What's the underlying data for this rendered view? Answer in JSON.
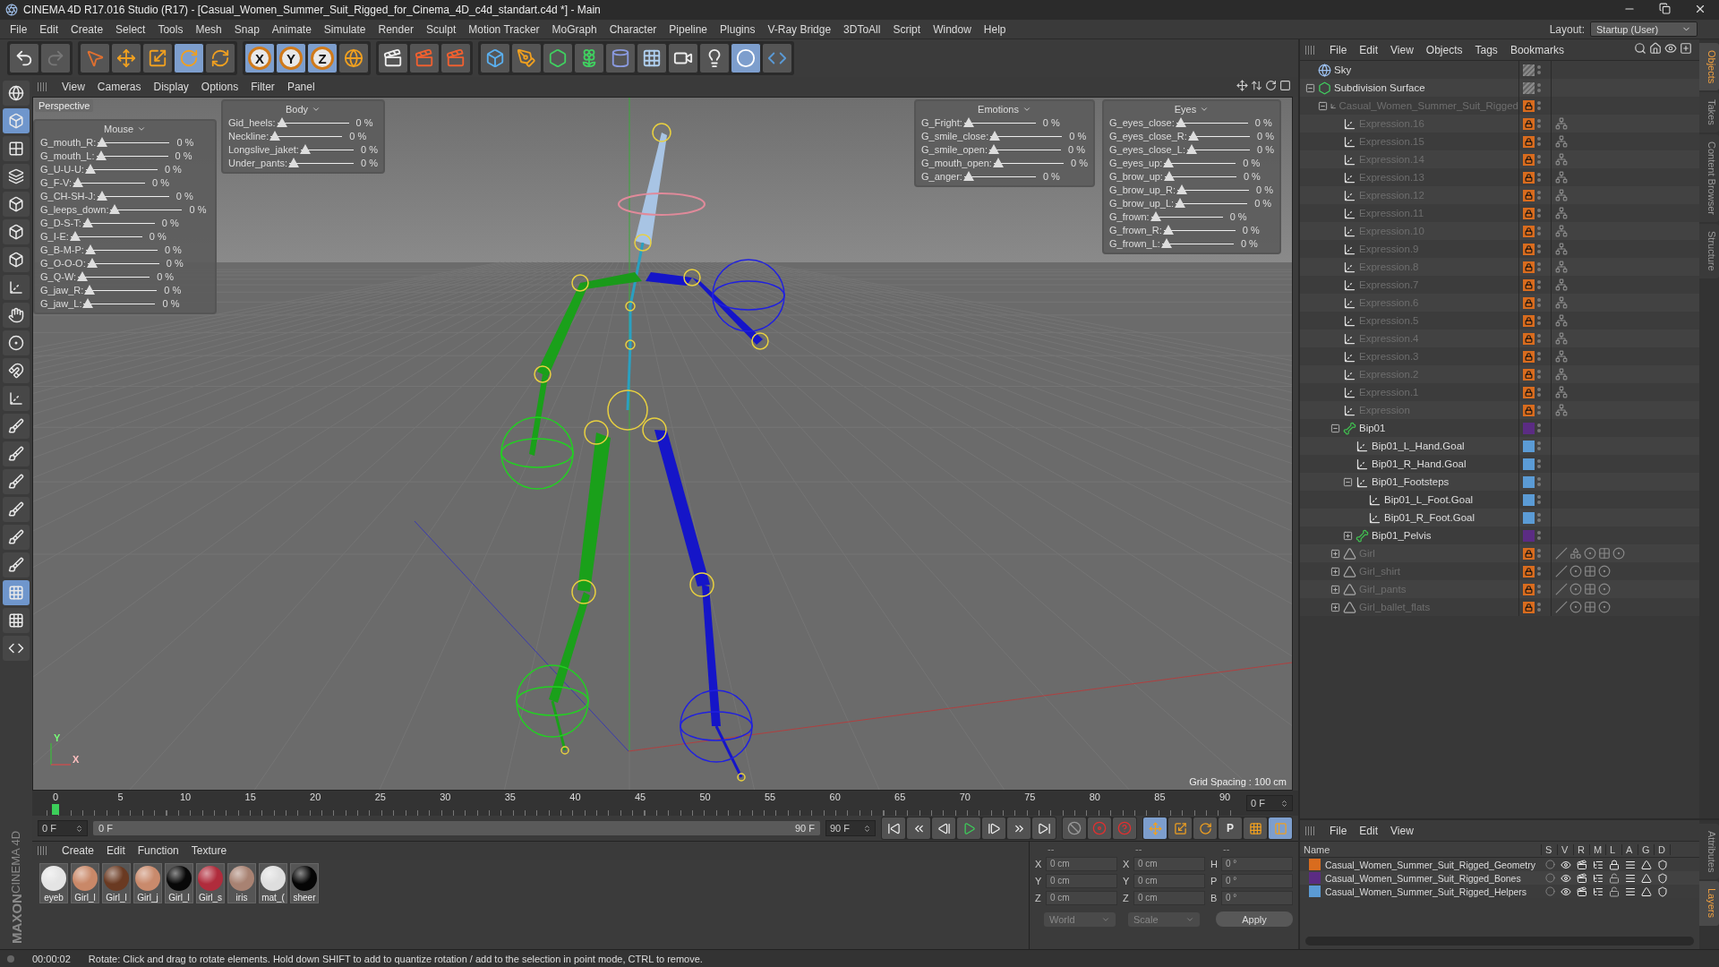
{
  "window": {
    "title": "CINEMA 4D R17.016 Studio (R17) - [Casual_Women_Summer_Suit_Rigged_for_Cinema_4D_c4d_standart.c4d *] - Main"
  },
  "menu": [
    "File",
    "Edit",
    "Create",
    "Select",
    "Tools",
    "Mesh",
    "Snap",
    "Animate",
    "Simulate",
    "Render",
    "Sculpt",
    "Motion Tracker",
    "MoGraph",
    "Character",
    "Pipeline",
    "Plugins",
    "V-Ray Bridge",
    "3DToAll",
    "Script",
    "Window",
    "Help"
  ],
  "layout": {
    "label": "Layout:",
    "value": "Startup (User)"
  },
  "toolbar": [
    {
      "tools": [
        {
          "kind": "undo",
          "selected": false
        },
        {
          "kind": "redo",
          "selected": false
        }
      ]
    },
    {
      "tools": [
        {
          "kind": "select",
          "selected": false
        },
        {
          "kind": "move",
          "selected": false
        },
        {
          "kind": "scale",
          "selected": false
        },
        {
          "kind": "rotate",
          "selected": true
        },
        {
          "kind": "recent",
          "selected": false
        }
      ]
    },
    {
      "tools": [
        {
          "kind": "axis",
          "label": "X",
          "selected": true
        },
        {
          "kind": "axis",
          "label": "Y",
          "selected": true
        },
        {
          "kind": "axis",
          "label": "Z",
          "selected": true
        },
        {
          "kind": "world",
          "selected": false
        }
      ]
    },
    {
      "tools": [
        {
          "kind": "render-view",
          "selected": false
        },
        {
          "kind": "render",
          "selected": false
        },
        {
          "kind": "render-settings",
          "selected": false
        }
      ]
    },
    {
      "tools": [
        {
          "kind": "cube",
          "selected": false
        },
        {
          "kind": "pen",
          "selected": false
        },
        {
          "kind": "subdivision",
          "selected": false
        },
        {
          "kind": "cloner",
          "selected": false
        },
        {
          "kind": "deformer",
          "selected": false
        },
        {
          "kind": "floor",
          "selected": false
        },
        {
          "kind": "camera",
          "selected": false
        },
        {
          "kind": "light",
          "selected": false
        },
        {
          "kind": "vray",
          "selected": true
        },
        {
          "kind": "python",
          "selected": false
        }
      ]
    }
  ],
  "side_tools": [
    {
      "kind": "viewport",
      "selected": false
    },
    {
      "kind": "model",
      "selected": true
    },
    {
      "kind": "texture",
      "selected": false
    },
    {
      "kind": "workplane",
      "selected": false
    },
    {
      "kind": "points",
      "selected": false
    },
    {
      "kind": "edges",
      "selected": false
    },
    {
      "kind": "polygons",
      "selected": false
    },
    {
      "kind": "axis",
      "selected": false
    },
    {
      "kind": "hand",
      "selected": false
    },
    {
      "kind": "snap",
      "selected": false
    },
    {
      "kind": "magnet",
      "selected": false
    },
    {
      "kind": "locked-axis",
      "selected": false
    },
    {
      "kind": "brush",
      "selected": false
    },
    {
      "kind": "brush",
      "selected": false
    },
    {
      "kind": "brush",
      "selected": false
    },
    {
      "kind": "brush",
      "selected": false
    },
    {
      "kind": "brush",
      "selected": false
    },
    {
      "kind": "brush",
      "selected": false
    },
    {
      "kind": "grid",
      "selected": true
    },
    {
      "kind": "grid",
      "selected": false
    },
    {
      "kind": "python",
      "selected": false
    }
  ],
  "logo": [
    "MAXON",
    "CINEMA 4D"
  ],
  "viewport": {
    "menu": [
      "View",
      "Cameras",
      "Display",
      "Options",
      "Filter",
      "Panel"
    ],
    "camera": "Perspective",
    "grid_spacing": "Grid Spacing : 100 cm",
    "gizmo_labels": [
      "Y",
      "X"
    ],
    "overlays": [
      {
        "title": "Mouse",
        "sliders": [
          {
            "label": "G_mouth_R:",
            "level": 0,
            "reading": "0 %"
          },
          {
            "label": "G_mouth_L:",
            "level": 0,
            "reading": "0 %"
          },
          {
            "label": "G_U-U-U:",
            "level": 0,
            "reading": "0 %"
          },
          {
            "label": "G_F-V:",
            "level": 0,
            "reading": "0 %"
          },
          {
            "label": "G_CH-SH-J:",
            "level": 0,
            "reading": "0 %"
          },
          {
            "label": "G_leeps_down:",
            "level": 0,
            "reading": "0 %"
          },
          {
            "label": "G_D-S-T:",
            "level": 0,
            "reading": "0 %"
          },
          {
            "label": "G_I-E:",
            "level": 0,
            "reading": "0 %"
          },
          {
            "label": "G_B-M-P:",
            "level": 0,
            "reading": "0 %"
          },
          {
            "label": "G_O-O-O:",
            "level": 0,
            "reading": "0 %"
          },
          {
            "label": "G_Q-W:",
            "level": 0,
            "reading": "0 %"
          },
          {
            "label": "G_jaw_R:",
            "level": 0,
            "reading": "0 %"
          },
          {
            "label": "G_jaw_L:",
            "level": 0,
            "reading": "0 %"
          }
        ]
      },
      {
        "title": "Body",
        "sliders": [
          {
            "label": "Gid_heels:",
            "level": 0,
            "reading": "0 %"
          },
          {
            "label": "Neckline:",
            "level": 0,
            "reading": "0 %"
          },
          {
            "label": "Longslive_jaket:",
            "level": 0,
            "reading": "0 %"
          },
          {
            "label": "Under_pants:",
            "level": 0,
            "reading": "0 %"
          }
        ]
      },
      {
        "title": "Emotions",
        "sliders": [
          {
            "label": "G_Fright:",
            "level": 0,
            "reading": "0 %"
          },
          {
            "label": "G_smile_close:",
            "level": 0,
            "reading": "0 %"
          },
          {
            "label": "G_smile_open:",
            "level": 0,
            "reading": "0 %"
          },
          {
            "label": "G_mouth_open:",
            "level": 0,
            "reading": "0 %"
          },
          {
            "label": "G_anger:",
            "level": 0,
            "reading": "0 %"
          }
        ]
      },
      {
        "title": "Eyes",
        "sliders": [
          {
            "label": "G_eyes_close:",
            "level": 0,
            "reading": "0 %"
          },
          {
            "label": "G_eyes_close_R:",
            "level": 0,
            "reading": "0 %"
          },
          {
            "label": "G_eyes_close_L:",
            "level": 0,
            "reading": "0 %"
          },
          {
            "label": "G_eyes_up:",
            "level": 0,
            "reading": "0 %"
          },
          {
            "label": "G_brow_up:",
            "level": 0,
            "reading": "0 %"
          },
          {
            "label": "G_brow_up_R:",
            "level": 0,
            "reading": "0 %"
          },
          {
            "label": "G_brow_up_L:",
            "level": 0,
            "reading": "0 %"
          },
          {
            "label": "G_frown:",
            "level": 0,
            "reading": "0 %"
          },
          {
            "label": "G_frown_R:",
            "level": 0,
            "reading": "0 %"
          },
          {
            "label": "G_frown_L:",
            "level": 0,
            "reading": "0 %"
          }
        ]
      }
    ]
  },
  "timeline": {
    "labels": [
      "0",
      "5",
      "10",
      "15",
      "20",
      "25",
      "30",
      "35",
      "40",
      "45",
      "50",
      "55",
      "60",
      "65",
      "70",
      "75",
      "80",
      "85",
      "90"
    ],
    "level": 0,
    "current": "0 F",
    "start": "0 F",
    "range": {
      "start": "0 F",
      "end": "90 F",
      "level": 1
    },
    "end": "90 F"
  },
  "transport": [
    {
      "kind": "first"
    },
    {
      "kind": "prev-key"
    },
    {
      "kind": "prev"
    },
    {
      "kind": "play"
    },
    {
      "kind": "next"
    },
    {
      "kind": "next-key"
    },
    {
      "kind": "last"
    }
  ],
  "record": [
    {
      "kind": "keyframe-off"
    },
    {
      "kind": "record"
    },
    {
      "kind": "auto-key"
    }
  ],
  "key_tools": [
    {
      "kind": "move",
      "selected": true
    },
    {
      "kind": "scale",
      "selected": false
    },
    {
      "kind": "rotate",
      "selected": false
    },
    {
      "kind": "param",
      "label": "P",
      "selected": false
    },
    {
      "kind": "points",
      "selected": false
    },
    {
      "kind": "timeline",
      "selected": true
    }
  ],
  "materials": {
    "menu": [
      "Create",
      "Edit",
      "Function",
      "Texture"
    ],
    "items": [
      {
        "name": "eyeb",
        "color": "#e4e4e4"
      },
      {
        "name": "Girl_l",
        "color": "#c98868"
      },
      {
        "name": "Girl_l",
        "color": "#6a3a22"
      },
      {
        "name": "Girl_j",
        "color": "#c98a6c"
      },
      {
        "name": "Girl_l",
        "color": "#080808"
      },
      {
        "name": "Girl_s",
        "color": "#b02c3c"
      },
      {
        "name": "iris",
        "color": "#a88272"
      },
      {
        "name": "mat_(",
        "color": "#dedede"
      },
      {
        "name": "sheer",
        "color": "#050505"
      }
    ]
  },
  "coordinates": {
    "headers": [
      "--",
      "--",
      "--"
    ],
    "rows": [
      [
        {
          "axis": "X",
          "value": "0 cm"
        },
        {
          "axis": "X",
          "value": "0 cm"
        },
        {
          "axis": "H",
          "value": "0 °"
        }
      ],
      [
        {
          "axis": "Y",
          "value": "0 cm"
        },
        {
          "axis": "Y",
          "value": "0 cm"
        },
        {
          "axis": "P",
          "value": "0 °"
        }
      ],
      [
        {
          "axis": "Z",
          "value": "0 cm"
        },
        {
          "axis": "Z",
          "value": "0 cm"
        },
        {
          "axis": "B",
          "value": "0 °"
        }
      ]
    ],
    "space": "World",
    "mode": "Scale",
    "apply": "Apply"
  },
  "objects": {
    "menu": [
      "File",
      "Edit",
      "View",
      "Objects",
      "Tags",
      "Bookmarks"
    ],
    "items": [
      {
        "name": "Sky",
        "kind": "sky",
        "dimmed": false
      },
      {
        "name": "Subdivision Surface",
        "kind": "subdivision",
        "dimmed": false,
        "expanded": true,
        "children": [
          {
            "name": "Casual_Women_Summer_Suit_Rigged",
            "kind": "null",
            "dimmed": true,
            "color": "#d96c1e",
            "locked": true,
            "expanded": true,
            "children": [
              {
                "name": "Expression.16",
                "kind": "null",
                "dimmed": true,
                "color": "#d96c1e",
                "locked": true,
                "tags": [
                  {
                    "kind": "xpresso"
                  }
                ]
              },
              {
                "name": "Expression.15",
                "kind": "null",
                "dimmed": true,
                "color": "#d96c1e",
                "locked": true,
                "tags": [
                  {
                    "kind": "xpresso"
                  }
                ]
              },
              {
                "name": "Expression.14",
                "kind": "null",
                "dimmed": true,
                "color": "#d96c1e",
                "locked": true,
                "tags": [
                  {
                    "kind": "xpresso"
                  }
                ]
              },
              {
                "name": "Expression.13",
                "kind": "null",
                "dimmed": true,
                "color": "#d96c1e",
                "locked": true,
                "tags": [
                  {
                    "kind": "xpresso"
                  }
                ]
              },
              {
                "name": "Expression.12",
                "kind": "null",
                "dimmed": true,
                "color": "#d96c1e",
                "locked": true,
                "tags": [
                  {
                    "kind": "xpresso"
                  }
                ]
              },
              {
                "name": "Expression.11",
                "kind": "null",
                "dimmed": true,
                "color": "#d96c1e",
                "locked": true,
                "tags": [
                  {
                    "kind": "xpresso"
                  }
                ]
              },
              {
                "name": "Expression.10",
                "kind": "null",
                "dimmed": true,
                "color": "#d96c1e",
                "locked": true,
                "tags": [
                  {
                    "kind": "xpresso"
                  }
                ]
              },
              {
                "name": "Expression.9",
                "kind": "null",
                "dimmed": true,
                "color": "#d96c1e",
                "locked": true,
                "tags": [
                  {
                    "kind": "xpresso"
                  }
                ]
              },
              {
                "name": "Expression.8",
                "kind": "null",
                "dimmed": true,
                "color": "#d96c1e",
                "locked": true,
                "tags": [
                  {
                    "kind": "xpresso"
                  }
                ]
              },
              {
                "name": "Expression.7",
                "kind": "null",
                "dimmed": true,
                "color": "#d96c1e",
                "locked": true,
                "tags": [
                  {
                    "kind": "xpresso"
                  }
                ]
              },
              {
                "name": "Expression.6",
                "kind": "null",
                "dimmed": true,
                "color": "#d96c1e",
                "locked": true,
                "tags": [
                  {
                    "kind": "xpresso"
                  }
                ]
              },
              {
                "name": "Expression.5",
                "kind": "null",
                "dimmed": true,
                "color": "#d96c1e",
                "locked": true,
                "tags": [
                  {
                    "kind": "xpresso"
                  }
                ]
              },
              {
                "name": "Expression.4",
                "kind": "null",
                "dimmed": true,
                "color": "#d96c1e",
                "locked": true,
                "tags": [
                  {
                    "kind": "xpresso"
                  }
                ]
              },
              {
                "name": "Expression.3",
                "kind": "null",
                "dimmed": true,
                "color": "#d96c1e",
                "locked": true,
                "tags": [
                  {
                    "kind": "xpresso"
                  }
                ]
              },
              {
                "name": "Expression.2",
                "kind": "null",
                "dimmed": true,
                "color": "#d96c1e",
                "locked": true,
                "tags": [
                  {
                    "kind": "xpresso"
                  }
                ]
              },
              {
                "name": "Expression.1",
                "kind": "null",
                "dimmed": true,
                "color": "#d96c1e",
                "locked": true,
                "tags": [
                  {
                    "kind": "xpresso"
                  }
                ]
              },
              {
                "name": "Expression",
                "kind": "null",
                "dimmed": true,
                "color": "#d96c1e",
                "locked": true,
                "tags": [
                  {
                    "kind": "xpresso"
                  }
                ]
              },
              {
                "name": "Bip01",
                "kind": "bone",
                "dimmed": false,
                "color": "#5b2c83",
                "locked": false,
                "expanded": true,
                "children": [
                  {
                    "name": "Bip01_L_Hand.Goal",
                    "kind": "null",
                    "dimmed": false,
                    "color": "#5b9bd5",
                    "locked": false
                  },
                  {
                    "name": "Bip01_R_Hand.Goal",
                    "kind": "null",
                    "dimmed": false,
                    "color": "#5b9bd5",
                    "locked": false
                  },
                  {
                    "name": "Bip01_Footsteps",
                    "kind": "null",
                    "dimmed": false,
                    "color": "#5b9bd5",
                    "locked": false,
                    "expanded": true,
                    "children": [
                      {
                        "name": "Bip01_L_Foot.Goal",
                        "kind": "null",
                        "dimmed": false,
                        "color": "#5b9bd5",
                        "locked": false
                      },
                      {
                        "name": "Bip01_R_Foot.Goal",
                        "kind": "null",
                        "dimmed": false,
                        "color": "#5b9bd5",
                        "locked": false
                      }
                    ]
                  },
                  {
                    "name": "Bip01_Pelvis",
                    "kind": "bone",
                    "dimmed": false,
                    "color": "#5b2c83",
                    "locked": false,
                    "expanded": false
                  }
                ]
              },
              {
                "name": "Girl",
                "kind": "polygon",
                "dimmed": true,
                "color": "#d96c1e",
                "locked": true,
                "expanded": false,
                "tags": [
                  {
                    "kind": "phong"
                  },
                  {
                    "kind": "selection"
                  },
                  {
                    "kind": "material"
                  },
                  {
                    "kind": "texture"
                  },
                  {
                    "kind": "material"
                  }
                ]
              },
              {
                "name": "Girl_shirt",
                "kind": "polygon",
                "dimmed": true,
                "color": "#d96c1e",
                "locked": true,
                "expanded": false,
                "tags": [
                  {
                    "kind": "phong"
                  },
                  {
                    "kind": "material"
                  },
                  {
                    "kind": "texture"
                  },
                  {
                    "kind": "material"
                  }
                ]
              },
              {
                "name": "Girl_pants",
                "kind": "polygon",
                "dimmed": true,
                "color": "#d96c1e",
                "locked": true,
                "expanded": false,
                "tags": [
                  {
                    "kind": "phong"
                  },
                  {
                    "kind": "material"
                  },
                  {
                    "kind": "texture"
                  },
                  {
                    "kind": "material"
                  }
                ]
              },
              {
                "name": "Girl_ballet_flats",
                "kind": "polygon",
                "dimmed": true,
                "color": "#d96c1e",
                "locked": true,
                "expanded": false,
                "tags": [
                  {
                    "kind": "phong"
                  },
                  {
                    "kind": "material"
                  },
                  {
                    "kind": "texture"
                  },
                  {
                    "kind": "material"
                  }
                ]
              }
            ]
          }
        ]
      }
    ]
  },
  "right_tabs": [
    {
      "label": "Objects",
      "selected": true
    },
    {
      "label": "Takes",
      "selected": false
    },
    {
      "label": "Content Browser",
      "selected": false
    },
    {
      "label": "Structure",
      "selected": false
    }
  ],
  "layers": {
    "menu": [
      "File",
      "Edit",
      "View"
    ],
    "columns": [
      "Name",
      "S",
      "V",
      "R",
      "M",
      "L",
      "A",
      "G",
      "D"
    ],
    "rows": [
      {
        "name": "Casual_Women_Summer_Suit_Rigged_Geometry",
        "color": "#d96c1e",
        "locked": true
      },
      {
        "name": "Casual_Women_Summer_Suit_Rigged_Bones",
        "color": "#5b2c83",
        "locked": false
      },
      {
        "name": "Casual_Women_Summer_Suit_Rigged_Helpers",
        "color": "#5b9bd5",
        "locked": false
      }
    ]
  },
  "bottom_tabs": [
    {
      "label": "Attributes",
      "selected": false
    },
    {
      "label": "Layers",
      "selected": true
    }
  ],
  "status": {
    "time": "00:00:02",
    "message": "Rotate: Click and drag to rotate elements. Hold down SHIFT to add to quantize rotation / add to the selection in point mode, CTRL to remove."
  }
}
